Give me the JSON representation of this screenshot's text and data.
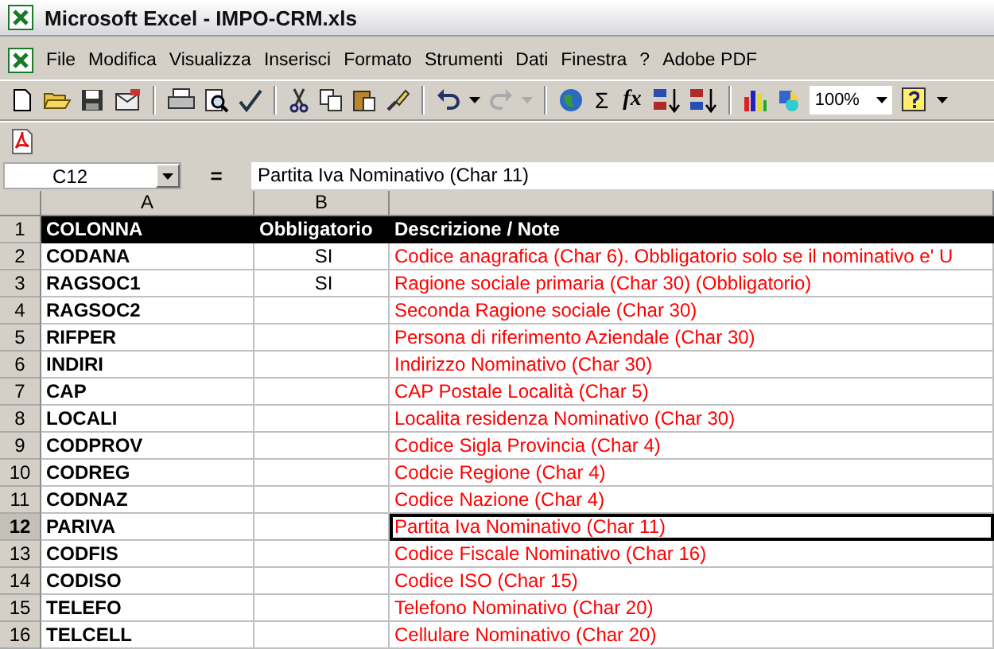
{
  "window": {
    "title": "Microsoft Excel - IMPO-CRM.xls"
  },
  "menu": [
    "File",
    "Modifica",
    "Visualizza",
    "Inserisci",
    "Formato",
    "Strumenti",
    "Dati",
    "Finestra",
    "?",
    "Adobe PDF"
  ],
  "toolbar": {
    "sum_glyph": "Σ",
    "function_glyph": "fx",
    "zoom": "100%"
  },
  "formula_bar": {
    "name_box": "C12",
    "equals": "=",
    "value": "Partita Iva Nominativo (Char 11)"
  },
  "columns": [
    "A",
    "B",
    ""
  ],
  "rows": [
    {
      "number": "1",
      "kind": "header",
      "selected": false,
      "cells": [
        "COLONNA",
        "Obbligatorio",
        "Descrizione / Note"
      ]
    },
    {
      "number": "2",
      "kind": "data",
      "selected": false,
      "cells": [
        "CODANA",
        "SI",
        "Codice anagrafica (Char 6). Obbligatorio solo se il nominativo e' U"
      ]
    },
    {
      "number": "3",
      "kind": "data",
      "selected": false,
      "cells": [
        "RAGSOC1",
        "SI",
        "Ragione sociale primaria (Char 30) (Obbligatorio)"
      ]
    },
    {
      "number": "4",
      "kind": "data",
      "selected": false,
      "cells": [
        "RAGSOC2",
        "",
        "Seconda Ragione sociale  (Char 30)"
      ]
    },
    {
      "number": "5",
      "kind": "data",
      "selected": false,
      "cells": [
        "RIFPER",
        "",
        "Persona di riferimento Aziendale (Char 30)"
      ]
    },
    {
      "number": "6",
      "kind": "data",
      "selected": false,
      "cells": [
        "INDIRI",
        "",
        "Indirizzo Nominativo  (Char 30)"
      ]
    },
    {
      "number": "7",
      "kind": "data",
      "selected": false,
      "cells": [
        "CAP",
        "",
        "CAP Postale Località  (Char 5)"
      ]
    },
    {
      "number": "8",
      "kind": "data",
      "selected": false,
      "cells": [
        "LOCALI",
        "",
        "Localita residenza Nominativo (Char 30)"
      ]
    },
    {
      "number": "9",
      "kind": "data",
      "selected": false,
      "cells": [
        "CODPROV",
        "",
        "Codice Sigla Provincia (Char 4)"
      ]
    },
    {
      "number": "10",
      "kind": "data",
      "selected": false,
      "cells": [
        "CODREG",
        "",
        "Codcie Regione (Char 4)"
      ]
    },
    {
      "number": "11",
      "kind": "data",
      "selected": false,
      "cells": [
        "CODNAZ",
        "",
        "Codice Nazione (Char 4)"
      ]
    },
    {
      "number": "12",
      "kind": "data",
      "selected": true,
      "cells": [
        "PARIVA",
        "",
        "Partita Iva Nominativo (Char 11)"
      ]
    },
    {
      "number": "13",
      "kind": "data",
      "selected": false,
      "cells": [
        "CODFIS",
        "",
        "Codice Fiscale Nominativo (Char 16)"
      ]
    },
    {
      "number": "14",
      "kind": "data",
      "selected": false,
      "cells": [
        "CODISO",
        "",
        "Codice ISO (Char 15)"
      ]
    },
    {
      "number": "15",
      "kind": "data",
      "selected": false,
      "cells": [
        "TELEFO",
        "",
        "Telefono Nominativo (Char 20)"
      ]
    },
    {
      "number": "16",
      "kind": "data",
      "selected": false,
      "cells": [
        "TELCELL",
        "",
        "Cellulare Nominativo (Char 20)"
      ]
    }
  ]
}
